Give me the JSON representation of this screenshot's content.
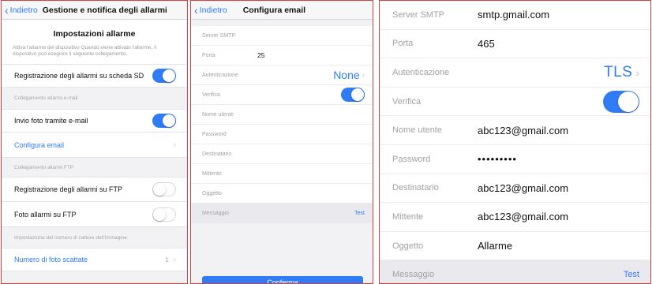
{
  "panel1": {
    "nav": {
      "back_label": "Indietro",
      "title": "Gestione e notifica degli allarmi"
    },
    "header": "Impostazioni allarme",
    "description": "Attiva l'allarme del dispositivo Quando viene attivato l'allarme, il dispositivo può eseguire il seguente collegamento.",
    "sd_recording": {
      "label": "Registrazione degli allarmi su scheda SD",
      "enabled": true
    },
    "section_email": "Collegamento allarmi e-mail",
    "email_photo": {
      "label": "Invio foto tramite e-mail",
      "enabled": true
    },
    "configure_email": "Configura email",
    "section_ftp": "Collegamento allarmi FTP",
    "ftp_recording": {
      "label": "Registrazione degli allarmi su FTP",
      "enabled": false
    },
    "ftp_photo": {
      "label": "Foto allarmi su FTP",
      "enabled": false
    },
    "section_photos": "Impostazione del numero di catture dell'immagine",
    "photo_count": {
      "label": "Numero di foto scattate",
      "value": "1"
    }
  },
  "panel2": {
    "nav": {
      "back_label": "Indietro",
      "title": "Configura email"
    },
    "fields": {
      "smtp": {
        "label": "Server SMTP",
        "value": ""
      },
      "port": {
        "label": "Porta",
        "value": "25"
      },
      "auth": {
        "label": "Autenticazione",
        "value": "None"
      },
      "verify": {
        "label": "Verifica",
        "enabled": true
      },
      "username": {
        "label": "Nome utente",
        "value": ""
      },
      "password": {
        "label": "Password",
        "value": ""
      },
      "recipient": {
        "label": "Destinatario",
        "value": ""
      },
      "sender": {
        "label": "Mittente",
        "value": ""
      },
      "subject": {
        "label": "Oggetto",
        "value": ""
      },
      "message": {
        "label": "Messaggio",
        "test": "Test"
      }
    },
    "save_label": "Conferma"
  },
  "panel3": {
    "fields": {
      "smtp": {
        "label": "Server SMTP",
        "value": "smtp.gmail.com"
      },
      "port": {
        "label": "Porta",
        "value": "465"
      },
      "auth": {
        "label": "Autenticazione",
        "value": "TLS"
      },
      "verify": {
        "label": "Verifica",
        "enabled": true
      },
      "username": {
        "label": "Nome utente",
        "value": "abc123@gmail.com"
      },
      "password": {
        "label": "Password",
        "value": "•••••••••"
      },
      "recipient": {
        "label": "Destinatario",
        "value": "abc123@gmail.com"
      },
      "sender": {
        "label": "Mittente",
        "value": "abc123@gmail.com"
      },
      "subject": {
        "label": "Oggetto",
        "value": "Allarme"
      },
      "message": {
        "label": "Messaggio",
        "test": "Test"
      }
    }
  },
  "colors": {
    "accent": "#2f7cf6",
    "frame": "#d84040",
    "group_bg": "#f2f2f5"
  },
  "icons": {
    "back": "chevron-left-icon",
    "disclosure": "chevron-right-icon"
  }
}
